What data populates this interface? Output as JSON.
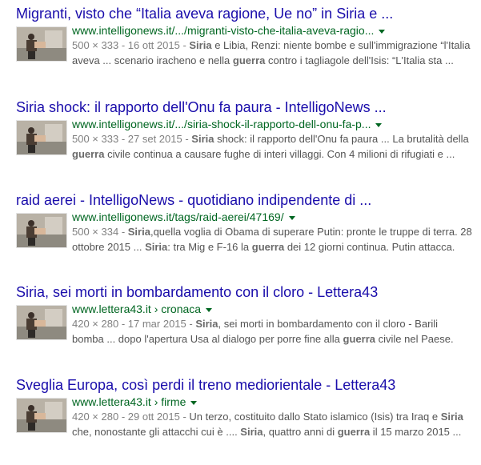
{
  "results": [
    {
      "title": "Migranti, visto che “Italia aveva ragione, Ue no” in Siria e ...",
      "url": "www.intelligonews.it/.../migranti-visto-che-italia-aveva-ragio...",
      "dims": "500 × 333",
      "date": "16 ott 2015",
      "snippet": [
        {
          "t": "Siria",
          "b": true
        },
        {
          "t": " e Libia, Renzi: niente bombe e sull'immigrazione “l'Italia aveva ... scenario iracheno e nella ",
          "b": false
        },
        {
          "t": "guerra",
          "b": true
        },
        {
          "t": " contro i tagliagole dell'Isis: “L'Italia sta ...",
          "b": false
        }
      ]
    },
    {
      "title": "Siria shock: il rapporto dell'Onu fa paura - IntelligoNews ...",
      "url": "www.intelligonews.it/.../siria-shock-il-rapporto-dell-onu-fa-p...",
      "dims": "500 × 333",
      "date": "27 set 2015",
      "snippet": [
        {
          "t": "Siria",
          "b": true
        },
        {
          "t": " shock: il rapporto dell'Onu fa paura ... La brutalità della ",
          "b": false
        },
        {
          "t": "guerra",
          "b": true
        },
        {
          "t": " civile continua a causare fughe di interi villaggi. Con 4 milioni di rifugiati e ...",
          "b": false
        }
      ]
    },
    {
      "title": "raid aerei - IntelligoNews - quotidiano indipendente di ...",
      "url": "www.intelligonews.it/tags/raid-aerei/47169/",
      "dims": "500 × 334",
      "date": "",
      "snippet": [
        {
          "t": "Siria",
          "b": true
        },
        {
          "t": ",quella voglia di Obama di superare Putin: pronte le truppe di terra. 28 ottobre 2015 ... ",
          "b": false
        },
        {
          "t": "Siria",
          "b": true
        },
        {
          "t": ": tra Mig e F-16 la ",
          "b": false
        },
        {
          "t": "guerra",
          "b": true
        },
        {
          "t": " dei 12 giorni continua. Putin attacca.",
          "b": false
        }
      ]
    },
    {
      "title": "Siria, sei morti in bombardamento con il cloro - Lettera43",
      "url": "www.lettera43.it › cronaca",
      "dims": "420 × 280",
      "date": "17 mar 2015",
      "snippet": [
        {
          "t": "Siria",
          "b": true
        },
        {
          "t": ", sei morti in bombardamento con il cloro - Barili bomba ... dopo l'apertura Usa al dialogo per porre fine alla ",
          "b": false
        },
        {
          "t": "guerra",
          "b": true
        },
        {
          "t": " civile nel Paese.",
          "b": false
        }
      ]
    },
    {
      "title": "Sveglia Europa, così perdi il treno mediorientale - Lettera43",
      "url": "www.lettera43.it › firme",
      "dims": "420 × 280",
      "date": "29 ott 2015",
      "snippet": [
        {
          "t": "Un terzo, costituito dallo Stato islamico (Isis) tra Iraq e ",
          "b": false
        },
        {
          "t": "Siria",
          "b": true
        },
        {
          "t": " che, nonostante gli attacchi cui è .... ",
          "b": false
        },
        {
          "t": "Siria",
          "b": true
        },
        {
          "t": ", quattro anni di ",
          "b": false
        },
        {
          "t": "guerra",
          "b": true
        },
        {
          "t": " il 15 marzo 2015 ...",
          "b": false
        }
      ]
    }
  ],
  "thumbnail_icon": "war-photo-thumbnail",
  "colors": {
    "title": "#1a0dab",
    "url": "#006621",
    "snippet": "#545454",
    "meta": "#808080"
  }
}
